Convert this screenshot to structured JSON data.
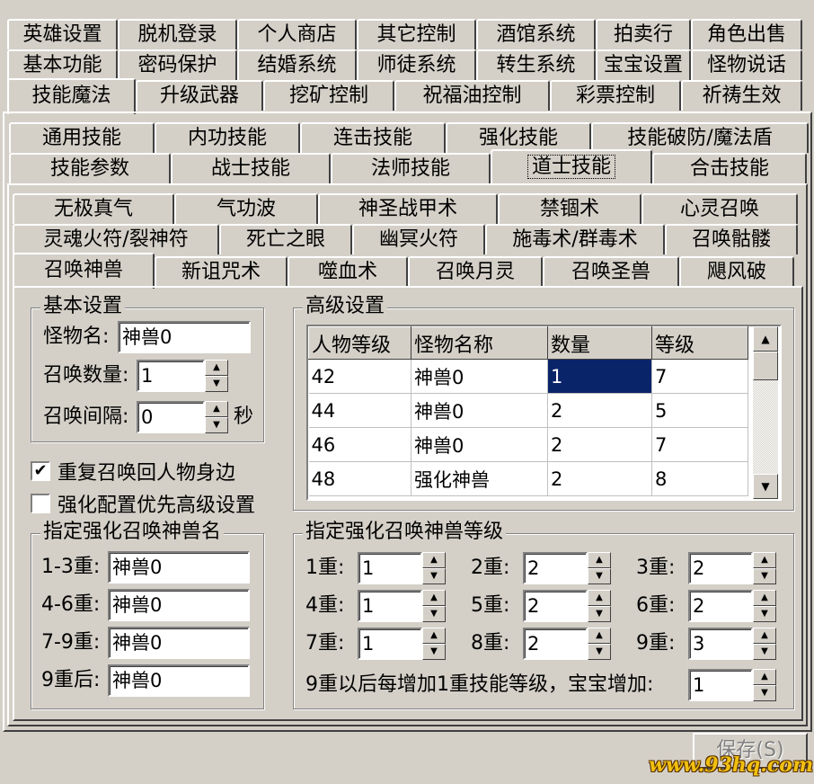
{
  "main_tabs": {
    "row1": [
      "英雄设置",
      "脱机登录",
      "个人商店",
      "其它控制",
      "酒馆系统",
      "拍卖行",
      "角色出售"
    ],
    "row2": [
      "基本功能",
      "密码保护",
      "结婚系统",
      "师徒系统",
      "转生系统",
      "宝宝设置",
      "怪物说话"
    ],
    "row3": [
      "技能魔法",
      "升级武器",
      "挖矿控制",
      "祝福油控制",
      "彩票控制",
      "祈祷生效"
    ]
  },
  "skill_tabs": {
    "row1": [
      "通用技能",
      "内功技能",
      "连击技能",
      "强化技能",
      "技能破防/魔法盾"
    ],
    "row2": [
      "技能参数",
      "战士技能",
      "法师技能",
      "道士技能",
      "合击技能"
    ]
  },
  "spell_tabs": {
    "row1": [
      "无极真气",
      "气功波",
      "神圣战甲术",
      "禁锢术",
      "心灵召唤"
    ],
    "row2": [
      "灵魂火符/裂神符",
      "死亡之眼",
      "幽冥火符",
      "施毒术/群毒术",
      "召唤骷髅"
    ],
    "row3": [
      "召唤神兽",
      "新诅咒术",
      "噬血术",
      "召唤月灵",
      "召唤圣兽",
      "飓风破"
    ]
  },
  "basic": {
    "title": "基本设置",
    "monster_name_label": "怪物名:",
    "monster_name": "神兽0",
    "count_label": "召唤数量:",
    "count": "1",
    "interval_label": "召唤间隔:",
    "interval": "0",
    "interval_unit": "秒"
  },
  "options": {
    "repeat_label": "重复召唤回人物身边",
    "repeat_checked": "✔",
    "prefer_label": "强化配置优先高级设置",
    "prefer_checked": ""
  },
  "advanced": {
    "title": "高级设置",
    "columns": [
      "人物等级",
      "怪物名称",
      "数量",
      "等级"
    ],
    "rows": [
      [
        "42",
        "神兽0",
        "1",
        "7"
      ],
      [
        "44",
        "神兽0",
        "2",
        "5"
      ],
      [
        "46",
        "神兽0",
        "2",
        "7"
      ],
      [
        "48",
        "强化神兽",
        "2",
        "8"
      ]
    ]
  },
  "enhanced_name": {
    "title": "指定强化召唤神兽名",
    "items": [
      {
        "label": "1-3重:",
        "value": "神兽0"
      },
      {
        "label": "4-6重:",
        "value": "神兽0"
      },
      {
        "label": "7-9重:",
        "value": "神兽0"
      },
      {
        "label": "9重后:",
        "value": "神兽0"
      }
    ]
  },
  "enhanced_level": {
    "title": "指定强化召唤神兽等级",
    "items": [
      {
        "label": "1重:",
        "value": "1"
      },
      {
        "label": "2重:",
        "value": "2"
      },
      {
        "label": "3重:",
        "value": "2"
      },
      {
        "label": "4重:",
        "value": "1"
      },
      {
        "label": "5重:",
        "value": "2"
      },
      {
        "label": "6重:",
        "value": "2"
      },
      {
        "label": "7重:",
        "value": "1"
      },
      {
        "label": "8重:",
        "value": "2"
      },
      {
        "label": "9重:",
        "value": "3"
      }
    ],
    "after9_label": "9重以后每增加1重技能等级，宝宝增加:",
    "after9_value": "1"
  },
  "save_label": "保存(S)",
  "watermark": "www.93hq.com",
  "colors": {
    "face": "#d4d0c8",
    "selection": "#0a246a",
    "watermark": "#f0c010"
  }
}
